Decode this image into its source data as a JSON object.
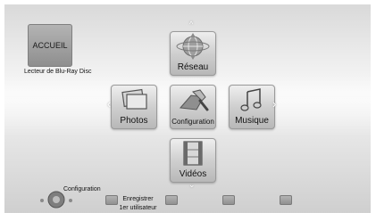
{
  "home": {
    "title": "ACCUEIL",
    "device_label": "Lecteur de Blu-Ray Disc"
  },
  "menu": {
    "network": "Réseau",
    "photos": "Photos",
    "configuration": "Configuration",
    "music": "Musique",
    "videos": "Vidéos"
  },
  "footer": {
    "setup_label": "Configuration",
    "register_line1": "Enregistrer",
    "register_line2": "1er utilisateur"
  }
}
